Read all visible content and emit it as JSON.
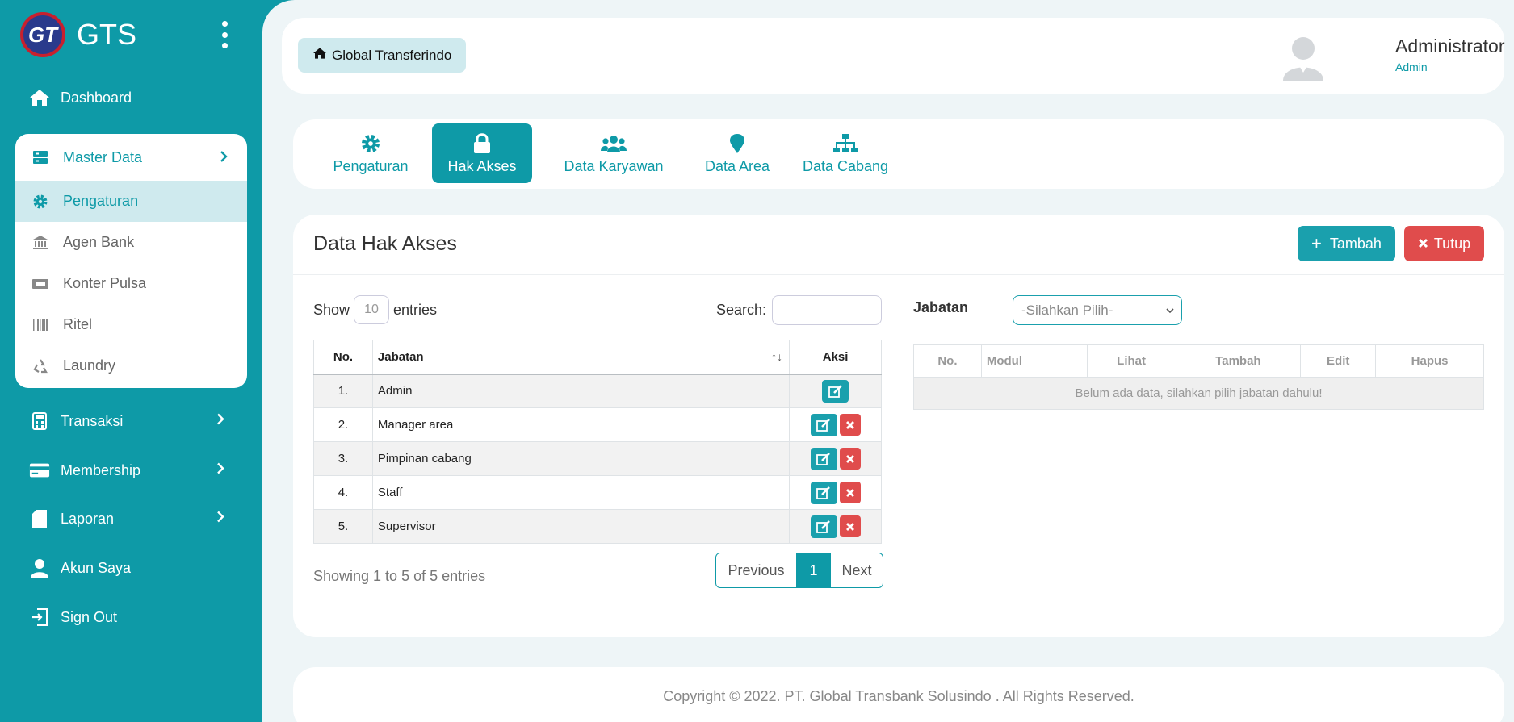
{
  "brand": {
    "name": "GTS",
    "logo_text": "GT"
  },
  "sidebar": {
    "dashboard": "Dashboard",
    "master_data": {
      "label": "Master Data",
      "items": [
        {
          "label": "Pengaturan"
        },
        {
          "label": "Agen Bank"
        },
        {
          "label": "Konter Pulsa"
        },
        {
          "label": "Ritel"
        },
        {
          "label": "Laundry"
        }
      ]
    },
    "transaksi": "Transaksi",
    "membership": "Membership",
    "laporan": "Laporan",
    "akun_saya": "Akun Saya",
    "sign_out": "Sign Out"
  },
  "topbar": {
    "breadcrumb": "Global Transferindo",
    "user_name": "Administrator",
    "user_role": "Admin"
  },
  "tabs": [
    {
      "label": "Pengaturan",
      "icon": "gear-icon"
    },
    {
      "label": "Hak Akses",
      "icon": "lock-icon"
    },
    {
      "label": "Data Karyawan",
      "icon": "users-icon"
    },
    {
      "label": "Data Area",
      "icon": "map-pin-icon"
    },
    {
      "label": "Data Cabang",
      "icon": "sitemap-icon"
    }
  ],
  "content": {
    "title": "Data Hak Akses",
    "btn_tambah": "Tambah",
    "btn_tutup": "Tutup",
    "show_label": "Show",
    "entries_value": "10",
    "entries_label": "entries",
    "search_label": "Search:",
    "table": {
      "headers": {
        "no": "No.",
        "jabatan": "Jabatan",
        "aksi": "Aksi"
      },
      "rows": [
        {
          "no": "1.",
          "jabatan": "Admin"
        },
        {
          "no": "2.",
          "jabatan": "Manager area"
        },
        {
          "no": "3.",
          "jabatan": "Pimpinan cabang"
        },
        {
          "no": "4.",
          "jabatan": "Staff"
        },
        {
          "no": "5.",
          "jabatan": "Supervisor"
        }
      ]
    },
    "showing": "Showing 1 to 5 of 5 entries",
    "pager": {
      "prev": "Previous",
      "page": "1",
      "next": "Next"
    },
    "jabatan_label": "Jabatan",
    "jabatan_select": "-Silahkan Pilih-",
    "perm_table": {
      "headers": {
        "no": "No.",
        "modul": "Modul",
        "lihat": "Lihat",
        "tambah": "Tambah",
        "edit": "Edit",
        "hapus": "Hapus"
      },
      "empty": "Belum ada data, silahkan pilih jabatan dahulu!"
    }
  },
  "footer": "Copyright © 2022. PT. Global Transbank Solusindo . All Rights Reserved.",
  "colors": {
    "primary": "#0e9aa7",
    "danger": "#e04c4c",
    "active_bg": "#cfeaee"
  }
}
